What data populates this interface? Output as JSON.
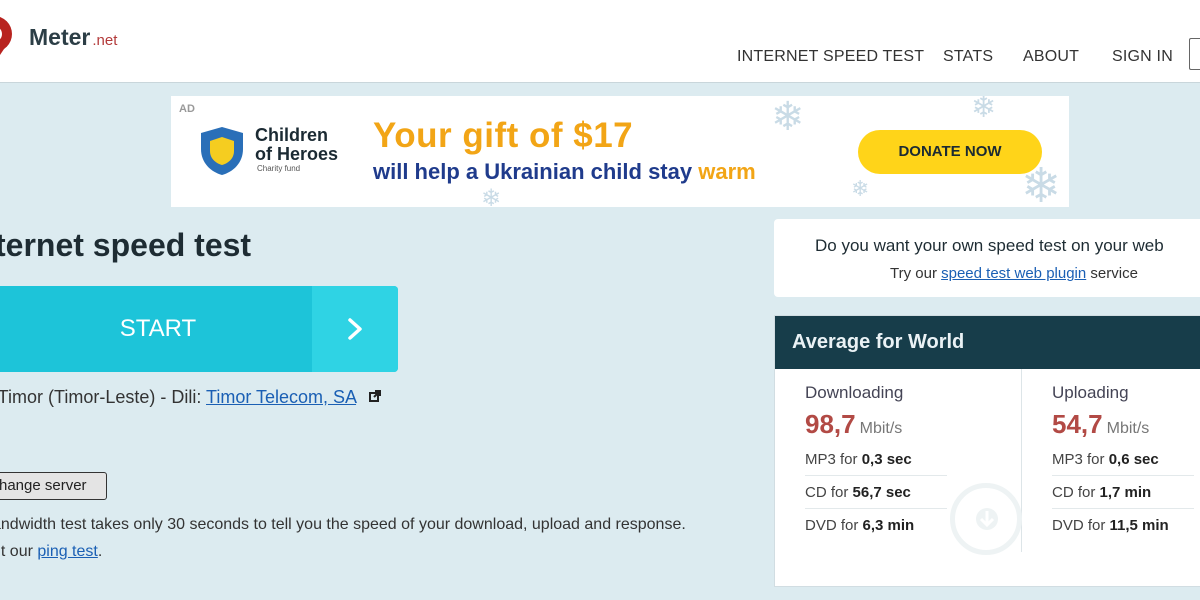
{
  "header": {
    "logo_main": "Meter",
    "logo_suffix": ".net",
    "nav": [
      "INTERNET SPEED TEST",
      "STATS",
      "ABOUT",
      "SIGN IN"
    ]
  },
  "ad": {
    "tag": "AD",
    "org_line1": "Children",
    "org_line2": "of Heroes",
    "org_sub": "Charity fund",
    "headline": "Your gift of $17",
    "subline": "will help a Ukrainian child stay ",
    "subline_highlight": "warm",
    "cta": "DONATE NOW"
  },
  "main": {
    "title": "ternet speed test",
    "start_label": "START",
    "server_text": "t Timor (Timor-Leste) - Dili: ",
    "server_link": "Timor Telecom, SA",
    "change_server": "hange server",
    "desc_line1": "andwidth test takes only 30 seconds to tell you the speed of your download, upload and response.",
    "desc_line2_pre": "ut our ",
    "desc_line2_link": "ping test",
    "desc_line2_post": "."
  },
  "promo": {
    "question": "Do you want your own speed test on your web",
    "try_pre": "Try our ",
    "try_link": "speed test web plugin",
    "try_post": " service"
  },
  "average": {
    "title": "Average for World",
    "download": {
      "label": "Downloading",
      "value": "98,7",
      "unit": "Mbit/s",
      "rows": [
        {
          "pre": "MP3 for ",
          "val": "0,3 sec"
        },
        {
          "pre": "CD for ",
          "val": "56,7 sec"
        },
        {
          "pre": "DVD for ",
          "val": "6,3 min"
        }
      ]
    },
    "upload": {
      "label": "Uploading",
      "value": "54,7",
      "unit": "Mbit/s",
      "rows": [
        {
          "pre": "MP3 for ",
          "val": "0,6 sec"
        },
        {
          "pre": "CD for ",
          "val": "1,7 min"
        },
        {
          "pre": "DVD for ",
          "val": "11,5 min"
        }
      ]
    }
  },
  "colors": {
    "accent": "#1dc4d9",
    "header_dark": "#173d4a",
    "speed_red": "#b24a45",
    "link_blue": "#1a5fb4",
    "donate_yellow": "#ffd419"
  },
  "icons": [
    "logo-pin-icon",
    "shield-icon",
    "snowflake-icon",
    "chevron-right-icon",
    "external-link-icon",
    "download-arrow-icon"
  ]
}
